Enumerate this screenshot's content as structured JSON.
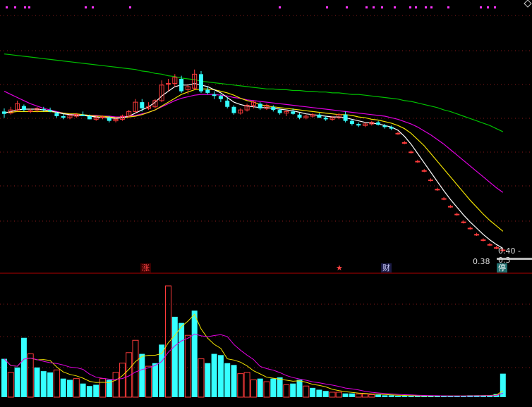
{
  "colors": {
    "background": "#000000",
    "up": "#ff3b3b",
    "down": "#35ffff",
    "grid": "#8a1a1a",
    "separator": "#b00000",
    "ma_white": "#ffffff",
    "ma_yellow": "#f0e000",
    "ma_magenta": "#e000e0",
    "ma_green": "#00c000",
    "dot_marker": "#ff33ff"
  },
  "icons": {
    "corner": "diamond-icon"
  },
  "price_panel": {
    "label_top_right": "0.40 - 0.3",
    "label_price": "0.38"
  },
  "event_markers": {
    "zhang": "涨",
    "star": "★",
    "cai": "财",
    "ting": "停"
  },
  "chart_data": [
    {
      "type": "candlestick",
      "title": "",
      "candles_ohlc": [
        [
          2.18,
          2.22,
          2.1,
          2.15
        ],
        [
          2.16,
          2.24,
          2.14,
          2.2
        ],
        [
          2.2,
          2.32,
          2.18,
          2.28
        ],
        [
          2.25,
          2.27,
          2.18,
          2.2
        ],
        [
          2.18,
          2.22,
          2.16,
          2.19
        ],
        [
          2.2,
          2.24,
          2.17,
          2.22
        ],
        [
          2.21,
          2.24,
          2.18,
          2.2
        ],
        [
          2.2,
          2.23,
          2.17,
          2.18
        ],
        [
          2.16,
          2.18,
          2.1,
          2.12
        ],
        [
          2.12,
          2.15,
          2.08,
          2.1
        ],
        [
          2.1,
          2.14,
          2.08,
          2.13
        ],
        [
          2.12,
          2.16,
          2.1,
          2.14
        ],
        [
          2.14,
          2.18,
          2.12,
          2.12
        ],
        [
          2.12,
          2.14,
          2.08,
          2.08
        ],
        [
          2.08,
          2.12,
          2.06,
          2.1
        ],
        [
          2.1,
          2.13,
          2.08,
          2.11
        ],
        [
          2.1,
          2.12,
          2.04,
          2.06
        ],
        [
          2.06,
          2.1,
          2.04,
          2.08
        ],
        [
          2.08,
          2.14,
          2.06,
          2.12
        ],
        [
          2.12,
          2.2,
          2.1,
          2.18
        ],
        [
          2.18,
          2.34,
          2.16,
          2.3
        ],
        [
          2.3,
          2.34,
          2.18,
          2.22
        ],
        [
          2.22,
          2.3,
          2.2,
          2.24
        ],
        [
          2.24,
          2.34,
          2.22,
          2.32
        ],
        [
          2.32,
          2.58,
          2.3,
          2.52
        ],
        [
          2.54,
          2.6,
          2.44,
          2.54
        ],
        [
          2.54,
          2.66,
          2.5,
          2.62
        ],
        [
          2.6,
          2.64,
          2.42,
          2.44
        ],
        [
          2.46,
          2.52,
          2.4,
          2.5
        ],
        [
          2.48,
          2.72,
          2.46,
          2.66
        ],
        [
          2.66,
          2.7,
          2.42,
          2.44
        ],
        [
          2.46,
          2.5,
          2.4,
          2.42
        ],
        [
          2.4,
          2.44,
          2.34,
          2.38
        ],
        [
          2.38,
          2.4,
          2.3,
          2.34
        ],
        [
          2.32,
          2.36,
          2.22,
          2.24
        ],
        [
          2.24,
          2.26,
          2.14,
          2.16
        ],
        [
          2.16,
          2.22,
          2.14,
          2.2
        ],
        [
          2.2,
          2.28,
          2.18,
          2.26
        ],
        [
          2.26,
          2.32,
          2.22,
          2.3
        ],
        [
          2.28,
          2.3,
          2.2,
          2.22
        ],
        [
          2.22,
          2.28,
          2.2,
          2.26
        ],
        [
          2.24,
          2.26,
          2.18,
          2.2
        ],
        [
          2.2,
          2.22,
          2.14,
          2.16
        ],
        [
          2.16,
          2.2,
          2.12,
          2.18
        ],
        [
          2.18,
          2.22,
          2.14,
          2.15
        ],
        [
          2.14,
          2.16,
          2.08,
          2.1
        ],
        [
          2.1,
          2.14,
          2.08,
          2.12
        ],
        [
          2.12,
          2.16,
          2.1,
          2.14
        ],
        [
          2.14,
          2.16,
          2.1,
          2.1
        ],
        [
          2.1,
          2.12,
          2.06,
          2.08
        ],
        [
          2.08,
          2.12,
          2.06,
          2.1
        ],
        [
          2.1,
          2.16,
          2.08,
          2.14
        ],
        [
          2.14,
          2.18,
          2.04,
          2.06
        ],
        [
          2.06,
          2.08,
          2.0,
          2.02
        ],
        [
          2.02,
          2.04,
          1.98,
          2.0
        ],
        [
          2.0,
          2.04,
          1.98,
          2.02
        ],
        [
          2.02,
          2.06,
          2.0,
          2.04
        ],
        [
          2.04,
          2.06,
          2.0,
          2.01
        ],
        [
          2.0,
          2.02,
          1.96,
          1.98
        ],
        [
          1.98,
          2.0,
          1.94,
          1.96
        ],
        [
          1.9,
          1.92,
          1.88,
          1.9
        ],
        [
          1.78,
          1.8,
          1.76,
          1.78
        ],
        [
          1.66,
          1.68,
          1.64,
          1.66
        ],
        [
          1.54,
          1.56,
          1.52,
          1.54
        ],
        [
          1.42,
          1.44,
          1.4,
          1.42
        ],
        [
          1.3,
          1.32,
          1.28,
          1.3
        ],
        [
          1.18,
          1.2,
          1.16,
          1.18
        ],
        [
          1.06,
          1.08,
          1.04,
          1.06
        ],
        [
          0.96,
          0.98,
          0.94,
          0.96
        ],
        [
          0.86,
          0.88,
          0.84,
          0.86
        ],
        [
          0.76,
          0.78,
          0.74,
          0.76
        ],
        [
          0.68,
          0.7,
          0.66,
          0.68
        ],
        [
          0.6,
          0.62,
          0.58,
          0.6
        ],
        [
          0.53,
          0.55,
          0.51,
          0.53
        ],
        [
          0.47,
          0.49,
          0.45,
          0.47
        ],
        [
          0.43,
          0.45,
          0.41,
          0.43
        ],
        [
          0.4,
          0.42,
          0.38,
          0.4
        ]
      ],
      "ma_white": [
        2.16,
        2.18,
        2.2,
        2.21,
        2.21,
        2.21,
        2.2,
        2.19,
        2.17,
        2.15,
        2.14,
        2.13,
        2.13,
        2.12,
        2.11,
        2.1,
        2.1,
        2.09,
        2.1,
        2.12,
        2.16,
        2.2,
        2.24,
        2.3,
        2.38,
        2.44,
        2.5,
        2.52,
        2.52,
        2.54,
        2.52,
        2.5,
        2.46,
        2.42,
        2.36,
        2.3,
        2.27,
        2.25,
        2.24,
        2.23,
        2.23,
        2.22,
        2.21,
        2.2,
        2.19,
        2.17,
        2.15,
        2.14,
        2.13,
        2.12,
        2.11,
        2.11,
        2.1,
        2.08,
        2.06,
        2.04,
        2.03,
        2.02,
        2.0,
        1.98,
        1.94,
        1.86,
        1.76,
        1.64,
        1.52,
        1.4,
        1.28,
        1.16,
        1.05,
        0.95,
        0.85,
        0.76,
        0.68,
        0.6,
        0.53,
        0.47,
        0.42
      ],
      "ma_yellow": [
        2.17,
        2.17,
        2.18,
        2.18,
        2.18,
        2.18,
        2.18,
        2.18,
        2.17,
        2.16,
        2.15,
        2.15,
        2.14,
        2.13,
        2.12,
        2.12,
        2.11,
        2.1,
        2.1,
        2.11,
        2.12,
        2.14,
        2.17,
        2.2,
        2.25,
        2.3,
        2.35,
        2.4,
        2.43,
        2.46,
        2.47,
        2.47,
        2.46,
        2.44,
        2.42,
        2.39,
        2.35,
        2.32,
        2.3,
        2.27,
        2.25,
        2.24,
        2.23,
        2.22,
        2.21,
        2.2,
        2.19,
        2.18,
        2.17,
        2.16,
        2.15,
        2.14,
        2.14,
        2.13,
        2.11,
        2.1,
        2.08,
        2.07,
        2.05,
        2.03,
        2.0,
        1.96,
        1.9,
        1.82,
        1.74,
        1.64,
        1.54,
        1.44,
        1.34,
        1.24,
        1.14,
        1.04,
        0.95,
        0.86,
        0.78,
        0.71,
        0.64
      ],
      "ma_magenta": [
        2.44,
        2.4,
        2.36,
        2.32,
        2.28,
        2.25,
        2.22,
        2.2,
        2.18,
        2.16,
        2.15,
        2.14,
        2.14,
        2.13,
        2.13,
        2.12,
        2.12,
        2.11,
        2.11,
        2.12,
        2.13,
        2.15,
        2.17,
        2.2,
        2.24,
        2.28,
        2.32,
        2.35,
        2.37,
        2.39,
        2.4,
        2.4,
        2.4,
        2.39,
        2.38,
        2.36,
        2.35,
        2.33,
        2.32,
        2.31,
        2.3,
        2.29,
        2.28,
        2.27,
        2.26,
        2.25,
        2.24,
        2.23,
        2.22,
        2.21,
        2.2,
        2.19,
        2.18,
        2.17,
        2.16,
        2.15,
        2.14,
        2.13,
        2.12,
        2.1,
        2.08,
        2.05,
        2.02,
        1.98,
        1.93,
        1.88,
        1.82,
        1.76,
        1.69,
        1.62,
        1.55,
        1.48,
        1.41,
        1.34,
        1.27,
        1.2,
        1.14
      ],
      "ma_green": [
        2.92,
        2.91,
        2.9,
        2.89,
        2.88,
        2.87,
        2.86,
        2.85,
        2.84,
        2.83,
        2.82,
        2.81,
        2.8,
        2.79,
        2.78,
        2.77,
        2.76,
        2.75,
        2.74,
        2.73,
        2.72,
        2.7,
        2.69,
        2.67,
        2.66,
        2.64,
        2.63,
        2.61,
        2.6,
        2.59,
        2.57,
        2.56,
        2.55,
        2.54,
        2.53,
        2.52,
        2.51,
        2.5,
        2.49,
        2.48,
        2.47,
        2.47,
        2.46,
        2.46,
        2.45,
        2.45,
        2.44,
        2.44,
        2.43,
        2.43,
        2.42,
        2.42,
        2.41,
        2.4,
        2.4,
        2.39,
        2.38,
        2.37,
        2.36,
        2.35,
        2.34,
        2.32,
        2.31,
        2.29,
        2.27,
        2.25,
        2.23,
        2.2,
        2.18,
        2.15,
        2.12,
        2.09,
        2.06,
        2.03,
        2.0,
        1.96,
        1.92
      ]
    },
    {
      "type": "bar",
      "title": "",
      "volume": [
        62,
        40,
        48,
        96,
        70,
        48,
        42,
        40,
        44,
        30,
        28,
        30,
        22,
        18,
        20,
        30,
        28,
        40,
        55,
        72,
        92,
        70,
        50,
        55,
        85,
        180,
        130,
        120,
        100,
        140,
        62,
        55,
        70,
        68,
        55,
        52,
        38,
        40,
        28,
        30,
        25,
        30,
        32,
        20,
        22,
        28,
        18,
        15,
        12,
        10,
        8,
        8,
        6,
        6,
        5,
        5,
        4,
        4,
        3,
        3,
        2,
        2,
        2,
        2,
        2,
        2,
        2,
        2,
        2,
        2,
        2,
        3,
        3,
        3,
        3,
        5,
        38
      ],
      "volume_up": [
        false,
        true,
        false,
        false,
        true,
        false,
        false,
        false,
        true,
        false,
        false,
        true,
        false,
        false,
        false,
        true,
        false,
        true,
        true,
        true,
        true,
        false,
        true,
        false,
        false,
        true,
        false,
        false,
        true,
        false,
        true,
        false,
        false,
        false,
        false,
        false,
        true,
        true,
        true,
        false,
        true,
        false,
        false,
        true,
        false,
        false,
        true,
        false,
        false,
        false,
        true,
        true,
        false,
        false,
        true,
        true,
        true,
        false,
        false,
        false,
        false,
        false,
        false,
        false,
        false,
        false,
        false,
        false,
        false,
        false,
        false,
        false,
        false,
        false,
        false,
        false,
        false
      ]
    }
  ]
}
